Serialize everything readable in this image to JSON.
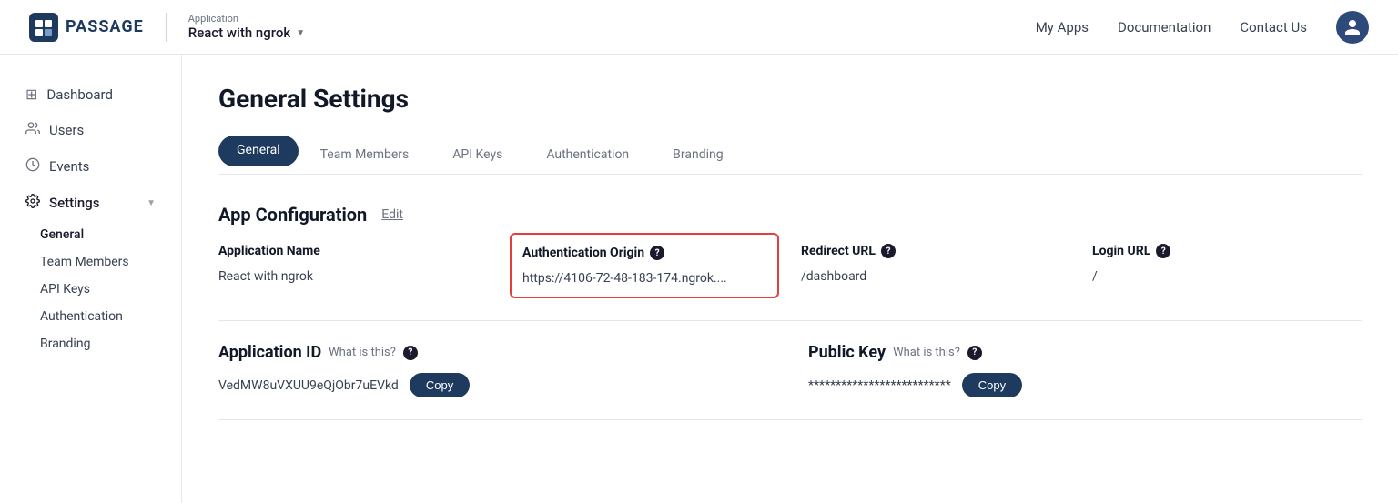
{
  "header": {
    "logo_text": "PASSAGE",
    "app_label": "Application",
    "app_name": "React with ngrok",
    "nav": {
      "my_apps": "My Apps",
      "documentation": "Documentation",
      "contact_us": "Contact Us"
    }
  },
  "sidebar": {
    "items": [
      {
        "id": "dashboard",
        "label": "Dashboard",
        "icon": "⊞"
      },
      {
        "id": "users",
        "label": "Users",
        "icon": "👤"
      },
      {
        "id": "events",
        "label": "Events",
        "icon": "🕐"
      },
      {
        "id": "settings",
        "label": "Settings",
        "icon": "⚙",
        "expanded": true
      }
    ],
    "sub_items": [
      {
        "id": "general",
        "label": "General",
        "active": true
      },
      {
        "id": "team-members",
        "label": "Team Members"
      },
      {
        "id": "api-keys",
        "label": "API Keys"
      },
      {
        "id": "authentication",
        "label": "Authentication"
      },
      {
        "id": "branding",
        "label": "Branding"
      }
    ]
  },
  "main": {
    "page_title": "General Settings",
    "tabs": [
      {
        "id": "general",
        "label": "General",
        "active": true
      },
      {
        "id": "team-members",
        "label": "Team Members"
      },
      {
        "id": "api-keys",
        "label": "API Keys"
      },
      {
        "id": "authentication",
        "label": "Authentication"
      },
      {
        "id": "branding",
        "label": "Branding"
      }
    ],
    "app_config": {
      "section_title": "App Configuration",
      "edit_label": "Edit",
      "fields": {
        "app_name": {
          "label": "Application Name",
          "value": "React with ngrok"
        },
        "auth_origin": {
          "label": "Authentication Origin",
          "value": "https://4106-72-48-183-174.ngrok....",
          "highlighted": true
        },
        "redirect_url": {
          "label": "Redirect URL",
          "value": "/dashboard"
        },
        "login_url": {
          "label": "Login URL",
          "value": "/"
        }
      }
    },
    "app_id": {
      "label": "Application ID",
      "what_is_this": "What is this?",
      "value": "VedMW8uVXUU9eQjObr7uEVkd",
      "copy_label": "Copy"
    },
    "public_key": {
      "label": "Public Key",
      "what_is_this": "What is this?",
      "value": "**************************",
      "copy_label": "Copy"
    }
  }
}
